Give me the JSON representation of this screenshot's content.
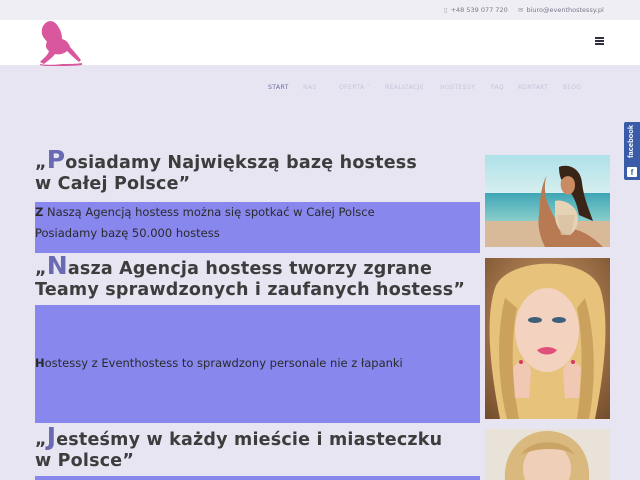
{
  "topbar": {
    "phone": "+48 539 077 720",
    "email": "biuro@eventhostessy.pl"
  },
  "nav": {
    "items": [
      "START",
      "NAS",
      "OFERTA",
      "REALIZACJE",
      "HOSTESSY",
      "FAQ",
      "KONTAKT",
      "BLOG"
    ],
    "active": "START"
  },
  "facebook": {
    "label": "facebook",
    "icon": "f"
  },
  "sections": [
    {
      "open_quote": "„",
      "initial": "P",
      "title_rest": "osiadamy Największą bazę hostess",
      "title_line2": "w Całej Polsce”",
      "body_initial": "Z",
      "body_line1_rest": " Naszą Agencją hostess można się spotkać w Całej Polsce",
      "body_line2": "Posiadamy bazę 50.000 hostess"
    },
    {
      "open_quote": "„",
      "initial": "N",
      "title_rest": "asza Agencja hostess tworzy zgrane",
      "title_line2": "Teamy sprawdzonych i zaufanych hostess”",
      "body_initial": "H",
      "body_line1_rest": "ostessy z Eventhostess to sprawdzony personale nie z łapanki"
    },
    {
      "open_quote": "„",
      "initial": "J",
      "title_rest": "esteśmy w każdy mieście i miasteczku",
      "title_line2": "w Polsce”"
    }
  ],
  "colors": {
    "background": "#e6e5f1",
    "band": "#8887ee",
    "accent": "#6a69b3",
    "logo": "#d9579c",
    "facebook": "#3a5ba8"
  },
  "icons": {
    "phone": "phone-icon",
    "email": "envelope-icon",
    "menu": "hamburger-menu-icon"
  }
}
